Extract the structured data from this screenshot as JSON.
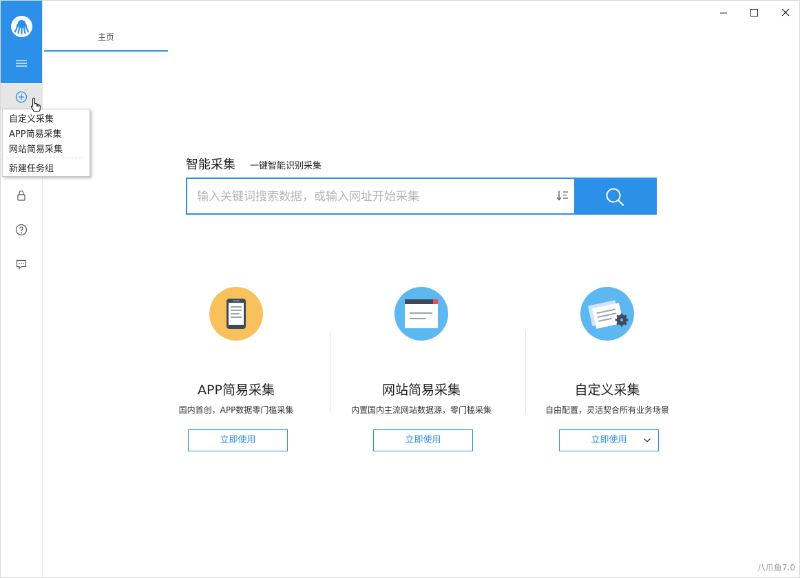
{
  "app": {
    "tab_home": "主页",
    "version": "八爪鱼7.0"
  },
  "window_controls": {
    "minimize_icon": "minimize-icon",
    "maximize_icon": "maximize-icon",
    "close_icon": "close-icon"
  },
  "sidebar": {
    "items": [
      {
        "icon": "octopus-logo"
      },
      {
        "icon": "menu-icon"
      },
      {
        "icon": "add-circle-icon"
      },
      {
        "icon": "lock-icon"
      },
      {
        "icon": "help-icon"
      },
      {
        "icon": "message-icon"
      }
    ]
  },
  "new_menu": {
    "items": [
      "自定义采集",
      "APP简易采集",
      "网站简易采集"
    ],
    "group_item": "新建任务组"
  },
  "smart": {
    "title": "智能采集",
    "subtitle": "一键智能识别采集",
    "placeholder": "输入关键词搜索数据，或输入网址开始采集"
  },
  "cards": [
    {
      "title": "APP简易采集",
      "desc": "国内首创，APP数据零门槛采集",
      "button": "立即使用",
      "color": "#f8c15c"
    },
    {
      "title": "网站简易采集",
      "desc": "内置国内主流网站数据源，零门槛采集",
      "button": "立即使用",
      "color": "#5db8f2"
    },
    {
      "title": "自定义采集",
      "desc": "自由配置，灵活契合所有业务场景",
      "button": "立即使用",
      "color": "#5db8f2"
    }
  ],
  "colors": {
    "accent": "#2c8fe8",
    "border": "#e3e3e3"
  }
}
